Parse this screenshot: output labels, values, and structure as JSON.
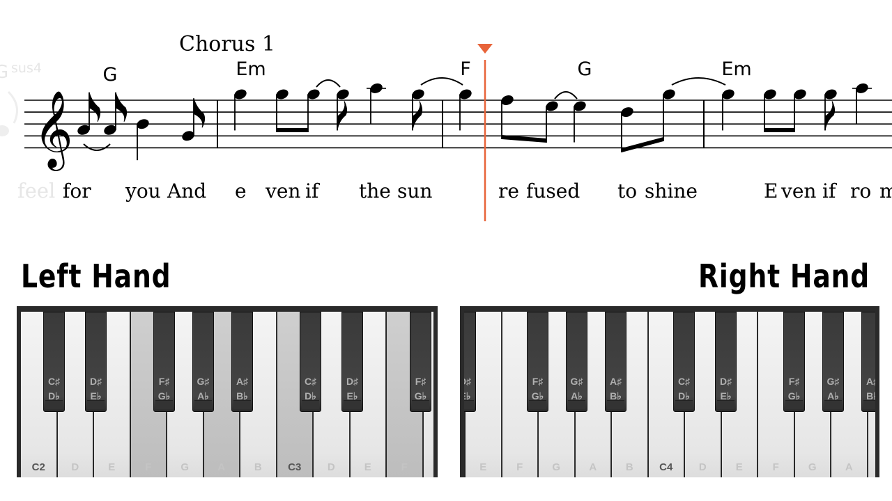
{
  "score": {
    "section_label": "Chorus 1",
    "faded_chord": {
      "root": "G",
      "suffix": "sus4"
    },
    "chords": [
      "G",
      "Em",
      "F",
      "G",
      "Em"
    ],
    "faded_lyric": "feel",
    "lyrics": [
      "for",
      "you",
      "And",
      "e",
      "ven",
      "if",
      "the",
      "sun",
      "re",
      "fused",
      "to",
      "shine",
      "E",
      "ven",
      "if",
      "ro",
      "m"
    ],
    "clef": "treble",
    "notes": [
      {
        "pitch": "A4",
        "duration": "eighth"
      },
      {
        "pitch": "A4",
        "duration": "eighth"
      },
      {
        "pitch": "B4",
        "duration": "quarter"
      },
      {
        "pitch": "G4",
        "duration": "eighth"
      },
      {
        "pitch": "G5",
        "duration": "quarter"
      },
      {
        "pitch": "G5",
        "duration": "eighth"
      },
      {
        "pitch": "G5",
        "duration": "eighth"
      },
      {
        "pitch": "G5",
        "duration": "eighth"
      },
      {
        "pitch": "A5",
        "duration": "quarter"
      },
      {
        "pitch": "G5",
        "duration": "eighth"
      },
      {
        "pitch": "G5",
        "duration": "quarter"
      },
      {
        "pitch": "F5",
        "duration": "eighth"
      },
      {
        "pitch": "E5",
        "duration": "eighth"
      },
      {
        "pitch": "E5",
        "duration": "quarter"
      },
      {
        "pitch": "D5",
        "duration": "eighth"
      },
      {
        "pitch": "G5",
        "duration": "eighth"
      },
      {
        "pitch": "G5",
        "duration": "quarter"
      },
      {
        "pitch": "G5",
        "duration": "eighth"
      },
      {
        "pitch": "G5",
        "duration": "eighth"
      },
      {
        "pitch": "G5",
        "duration": "eighth"
      },
      {
        "pitch": "A5",
        "duration": "quarter"
      }
    ],
    "playhead_color": "#e8643a"
  },
  "left_hand": {
    "title": "Left Hand",
    "white_keys": [
      "C2",
      "D",
      "E",
      "F",
      "G",
      "A",
      "B",
      "C3",
      "D",
      "E",
      "F",
      ""
    ],
    "pressed": [
      "F",
      "A",
      "C3"
    ],
    "black_keys": [
      [
        "C♯",
        "D♭"
      ],
      [
        "D♯",
        "E♭"
      ],
      [
        "F♯",
        "G♭"
      ],
      [
        "G♯",
        "A♭"
      ],
      [
        "A♯",
        "B♭"
      ],
      [
        "C♯",
        "D♭"
      ],
      [
        "D♯",
        "E♭"
      ],
      [
        "F♯",
        "G♭"
      ]
    ]
  },
  "right_hand": {
    "title": "Right Hand",
    "white_keys": [
      "E",
      "F",
      "G",
      "A",
      "B",
      "C4",
      "D",
      "E",
      "F",
      "G",
      "A",
      ""
    ],
    "pressed": [],
    "black_keys": [
      [
        "D♯",
        "E♭"
      ],
      [
        "F♯",
        "G♭"
      ],
      [
        "G♯",
        "A♭"
      ],
      [
        "A♯",
        "B♭"
      ],
      [
        "C♯",
        "D♭"
      ],
      [
        "D♯",
        "E♭"
      ],
      [
        "F♯",
        "G♭"
      ],
      [
        "G♯",
        "A♭"
      ],
      [
        "A♯",
        "B♭"
      ]
    ]
  }
}
